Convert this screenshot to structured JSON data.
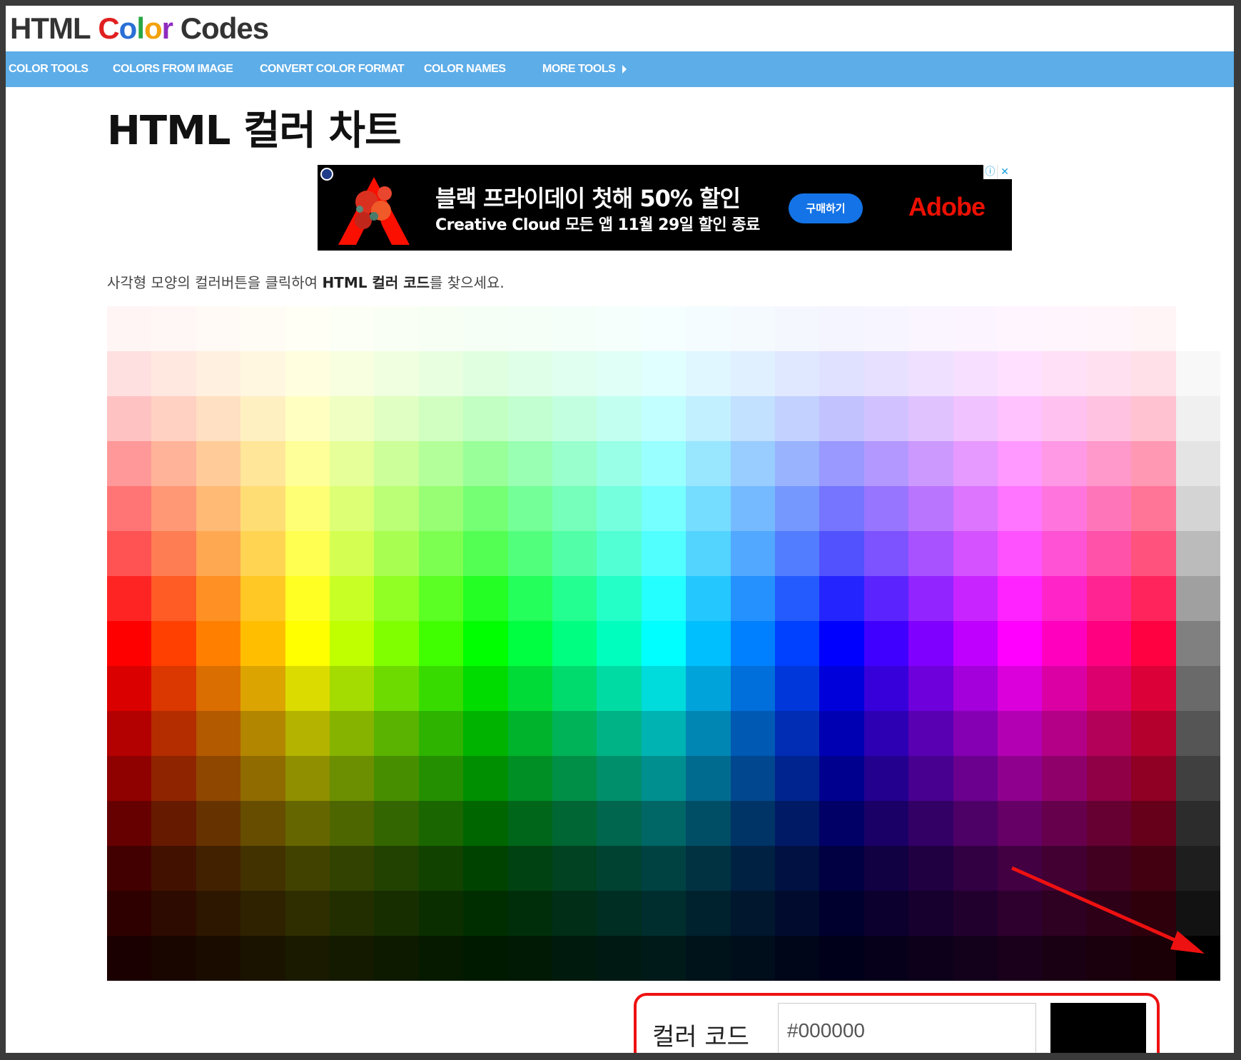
{
  "header": {
    "logo_letters": [
      {
        "ch": "H",
        "color": "#333333"
      },
      {
        "ch": "T",
        "color": "#333333"
      },
      {
        "ch": "M",
        "color": "#333333"
      },
      {
        "ch": "L",
        "color": "#333333"
      },
      {
        "ch": " ",
        "color": "#333333"
      },
      {
        "ch": "C",
        "color": "#e02020"
      },
      {
        "ch": "o",
        "color": "#2a6fd6"
      },
      {
        "ch": "l",
        "color": "#28a745"
      },
      {
        "ch": "o",
        "color": "#f2a20c"
      },
      {
        "ch": "r",
        "color": "#8e2bc0"
      },
      {
        "ch": " ",
        "color": "#333333"
      },
      {
        "ch": "C",
        "color": "#333333"
      },
      {
        "ch": "o",
        "color": "#333333"
      },
      {
        "ch": "d",
        "color": "#333333"
      },
      {
        "ch": "e",
        "color": "#333333"
      },
      {
        "ch": "s",
        "color": "#333333"
      }
    ]
  },
  "nav": {
    "items": [
      {
        "label": "COLOR TOOLS",
        "name": "nav-color-tools"
      },
      {
        "label": "COLORS FROM IMAGE",
        "name": "nav-colors-from-image"
      },
      {
        "label": "CONVERT COLOR FORMAT",
        "name": "nav-convert-color-format"
      },
      {
        "label": "COLOR NAMES",
        "name": "nav-color-names"
      },
      {
        "label": "MORE TOOLS",
        "name": "nav-more-tools",
        "caret": true
      }
    ],
    "bar_color": "#5dade8"
  },
  "page": {
    "title": "HTML 컬러 차트",
    "instruction_pre": "사각형 모양의 컬러버튼을 클릭하여 ",
    "instruction_bold": "HTML 컬러 코드",
    "instruction_post": "를 찾으세요."
  },
  "ad": {
    "headline": "블랙 프라이데이 첫해 50% 할인",
    "subline": "Creative Cloud 모든 앱 11월 29일 할인 종료",
    "cta": "구매하기",
    "brand": "Adobe",
    "info_icon": "ⓘ",
    "close_icon": "✕"
  },
  "color_grid": {
    "hues": [
      0,
      15,
      30,
      45,
      60,
      75,
      90,
      105,
      120,
      135,
      150,
      165,
      180,
      195,
      210,
      225,
      240,
      255,
      270,
      285,
      300,
      315,
      330,
      345
    ],
    "lightness_rows": [
      98,
      94,
      88,
      80,
      73,
      66,
      57,
      50,
      43,
      35,
      28,
      20,
      13,
      9,
      5
    ],
    "gray_column": [
      "#ffffff",
      "#f8f8f8",
      "#f0f0f0",
      "#e4e4e4",
      "#d4d4d4",
      "#bbbbbb",
      "#a0a0a0",
      "#808080",
      "#6a6a6a",
      "#555555",
      "#404040",
      "#2c2c2c",
      "#1e1e1e",
      "#121212",
      "#000000"
    ]
  },
  "code_box": {
    "label": "컬러 코드",
    "value": "#000000",
    "preview_color": "#000000",
    "highlight_color": "#ee1111"
  }
}
